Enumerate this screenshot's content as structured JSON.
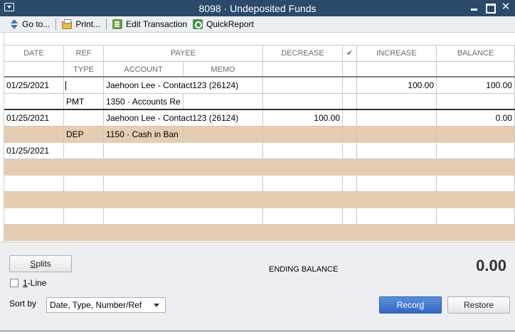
{
  "window": {
    "title": "8098 · Undeposited Funds"
  },
  "toolbar": {
    "goto_label": "Go to...",
    "print_label": "Print...",
    "edit_label": "Edit Transaction",
    "quickreport_label": "QuickReport"
  },
  "columns": {
    "date": "DATE",
    "ref": "REF",
    "type": "TYPE",
    "payee": "PAYEE",
    "account": "ACCOUNT",
    "memo": "MEMO",
    "decrease": "DECREASE",
    "cleared": "✔",
    "increase": "INCREASE",
    "balance": "BALANCE"
  },
  "transactions": [
    {
      "date": "01/25/2021",
      "ref": "",
      "type": "PMT",
      "payee": "Jaehoon Lee - Contact123 (26124)",
      "account": "1350 · Accounts Re",
      "memo": "",
      "decrease": "",
      "increase": "100.00",
      "balance": "100.00"
    },
    {
      "date": "01/25/2021",
      "ref": "",
      "type": "DEP",
      "payee": "Jaehoon Lee - Contact123 (26124)",
      "account": "1150 · Cash in Ban",
      "memo": "",
      "decrease": "100.00",
      "increase": "",
      "balance": "0.00"
    },
    {
      "date": "01/25/2021"
    }
  ],
  "footer": {
    "splits_label_u": "S",
    "splits_label_rest": "plits",
    "oneline_u": "1",
    "oneline_rest": "-Line",
    "ending_balance_label": "ENDING BALANCE",
    "ending_balance_value": "0.00",
    "sortby_label": "Sort by",
    "sortby_value": "Date, Type, Number/Ref",
    "record_pre": "Recor",
    "record_u": "d",
    "restore_label": "Restore"
  }
}
